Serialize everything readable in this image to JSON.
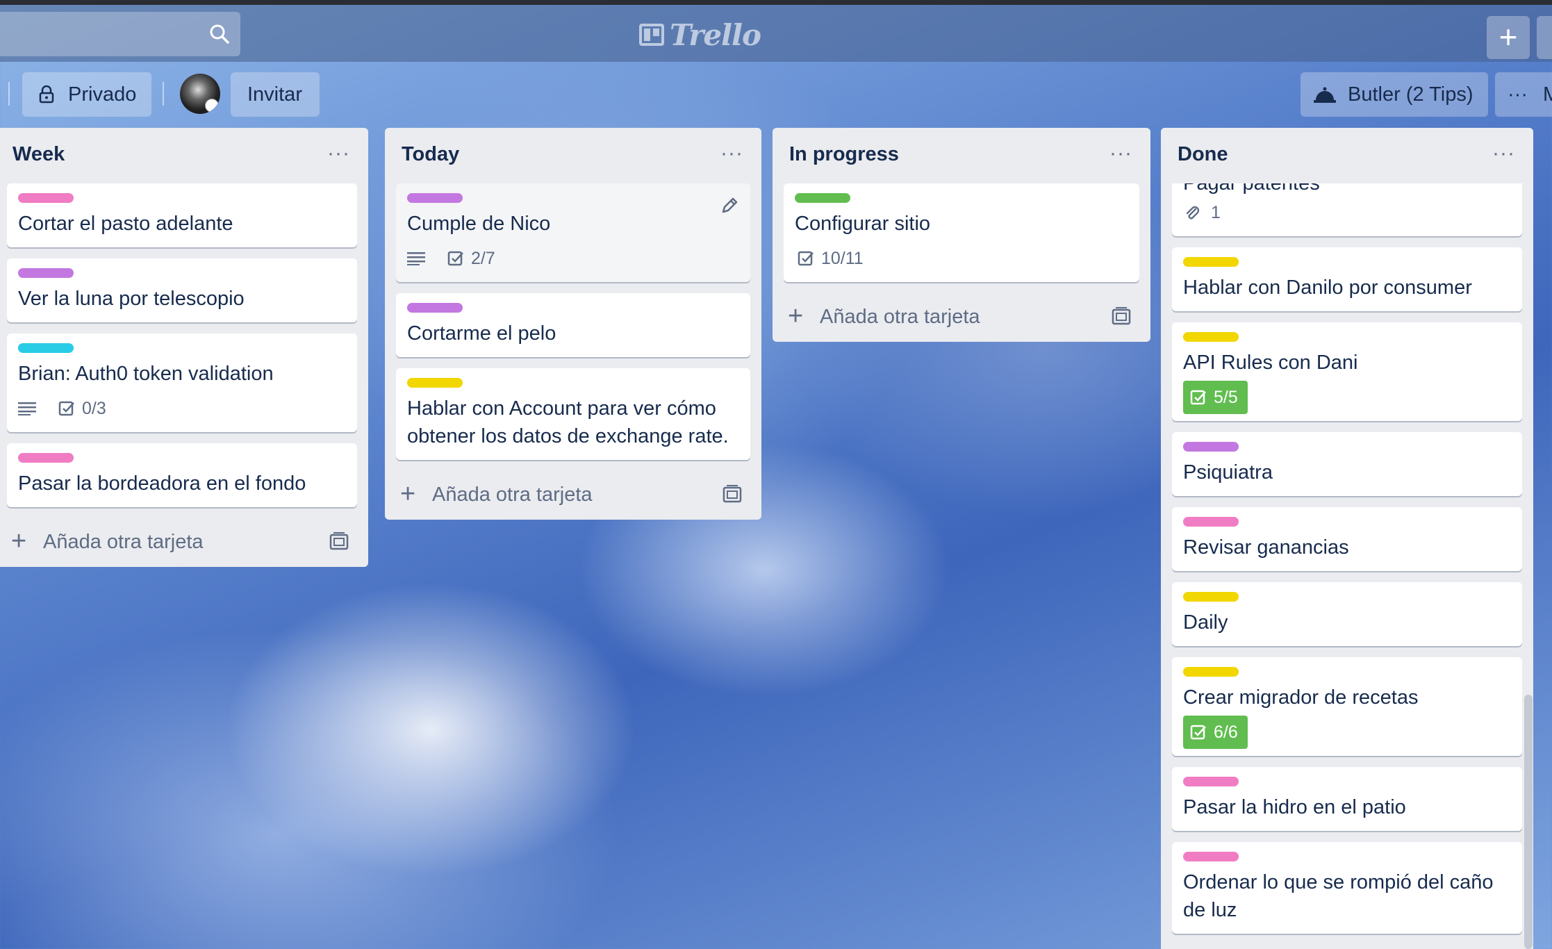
{
  "colors": {
    "pink": "#f07dc3",
    "purple": "#c377e0",
    "sky": "#29cce5",
    "yellow": "#f2d600",
    "green": "#61bd4f"
  },
  "header": {
    "logo_text": "Trello",
    "search_icon": "search-icon",
    "create_icon": "plus-icon",
    "create_label": "+"
  },
  "board_bar": {
    "privacy_label": "Privado",
    "invite_label": "Invitar",
    "butler_label": "Butler (2 Tips)",
    "menu_label": "···",
    "menu_text_partial": "M"
  },
  "lists": [
    {
      "title": "Week",
      "menu": "···",
      "add_label": "Añada otra tarjeta",
      "cards": [
        {
          "label": "pink",
          "title": "Cortar el pasto adelante"
        },
        {
          "label": "purple",
          "title": "Ver la luna por telescopio"
        },
        {
          "label": "sky",
          "title": "Brian: Auth0 token validation",
          "description": true,
          "checklist": "0/3"
        },
        {
          "label": "pink",
          "title": "Pasar la bordeadora en el fondo"
        }
      ]
    },
    {
      "title": "Today",
      "menu": "···",
      "add_label": "Añada otra tarjeta",
      "cards": [
        {
          "label": "purple",
          "title": "Cumple de Nico",
          "description": true,
          "checklist": "2/7",
          "hovered": true
        },
        {
          "label": "purple",
          "title": "Cortarme el pelo"
        },
        {
          "label": "yellow",
          "title": "Hablar con Account para ver cómo obtener los datos de exchange rate."
        }
      ]
    },
    {
      "title": "In progress",
      "menu": "···",
      "add_label": "Añada otra tarjeta",
      "cards": [
        {
          "label": "green",
          "title": "Configurar sitio",
          "checklist": "10/11"
        }
      ]
    },
    {
      "title": "Done",
      "menu": "···",
      "cards": [
        {
          "title": "Pagar patentes",
          "attachments": "1"
        },
        {
          "label": "yellow",
          "title": "Hablar con Danilo por consumer"
        },
        {
          "label": "yellow",
          "title": "API Rules con Dani",
          "checklist": "5/5",
          "complete": true
        },
        {
          "label": "purple",
          "title": "Psiquiatra"
        },
        {
          "label": "pink",
          "title": "Revisar ganancias"
        },
        {
          "label": "yellow",
          "title": "Daily"
        },
        {
          "label": "yellow",
          "title": "Crear migrador de recetas",
          "checklist": "6/6",
          "complete": true
        },
        {
          "label": "pink",
          "title": "Pasar la hidro en el patio"
        },
        {
          "label": "pink",
          "title": "Ordenar lo que se rompió del caño de luz"
        }
      ]
    }
  ]
}
